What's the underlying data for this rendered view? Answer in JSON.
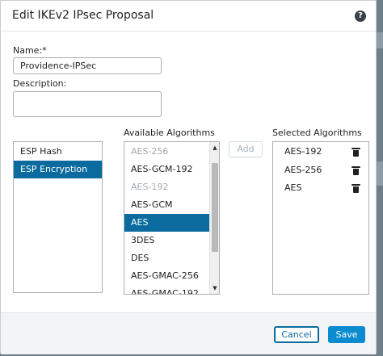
{
  "dialog": {
    "title": "Edit IKEv2 IPsec Proposal",
    "help_symbol": "?"
  },
  "form": {
    "name_label": "Name:*",
    "name_value": "Providence-IPSec",
    "description_label": "Description:",
    "description_value": ""
  },
  "categories": {
    "items": [
      {
        "label": "ESP Hash",
        "selected": false
      },
      {
        "label": "ESP Encryption",
        "selected": true
      }
    ]
  },
  "available": {
    "heading": "Available Algorithms",
    "items": [
      {
        "label": "AES-256",
        "disabled": true,
        "selected": false
      },
      {
        "label": "AES-GCM-192",
        "disabled": false,
        "selected": false
      },
      {
        "label": "AES-192",
        "disabled": true,
        "selected": false
      },
      {
        "label": "AES-GCM",
        "disabled": false,
        "selected": false
      },
      {
        "label": "AES",
        "disabled": false,
        "selected": true
      },
      {
        "label": "3DES",
        "disabled": false,
        "selected": false
      },
      {
        "label": "DES",
        "disabled": false,
        "selected": false
      },
      {
        "label": "AES-GMAC-256",
        "disabled": false,
        "selected": false
      },
      {
        "label": "AES-GMAC-192",
        "disabled": false,
        "selected": false
      }
    ]
  },
  "add_button": "Add",
  "selected": {
    "heading": "Selected Algorithms",
    "items": [
      "AES-192",
      "AES-256",
      "AES"
    ]
  },
  "footer": {
    "cancel_label": "Cancel",
    "save_label": "Save"
  },
  "colors": {
    "accent": "#0b6b9e",
    "save": "#0b8bd0"
  }
}
